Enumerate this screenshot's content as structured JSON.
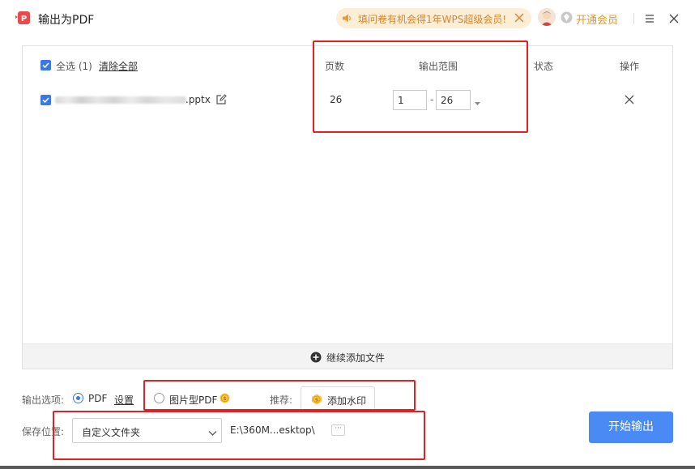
{
  "window": {
    "title": "输出为PDF",
    "promo_text": "填问卷有机会得1年WPS超级会员!",
    "vip_text": "开通会员"
  },
  "file_list": {
    "select_all_label": "全选 (1)",
    "clear_all_label": "清除全部",
    "columns": {
      "pages": "页数",
      "range": "输出范围",
      "status": "状态",
      "action": "操作"
    },
    "files": [
      {
        "name_suffix": ".pptx",
        "checked": true,
        "pages": "26",
        "range_from": "1",
        "range_separator": "-",
        "range_to": "26",
        "status": ""
      }
    ],
    "add_files_label": "继续添加文件"
  },
  "options": {
    "output_options_label": "输出选项:",
    "pdf_label": "PDF",
    "pdf_selected": true,
    "settings_label": "设置",
    "image_pdf_label": "图片型PDF",
    "recommend_label": "推荐:",
    "watermark_label": "添加水印"
  },
  "save": {
    "label": "保存位置:",
    "folder_option": "自定义文件夹",
    "path": "E:\\360M...esktop\\",
    "browse_label": "···"
  },
  "actions": {
    "start_export_label": "开始输出"
  },
  "colors": {
    "accent": "#3b78e7",
    "primary_button": "#4a8af4",
    "promo_background": "#fdefd7",
    "promo_text": "#d9822b",
    "vip_text": "#e7962a",
    "annotation_red": "#e62020"
  }
}
